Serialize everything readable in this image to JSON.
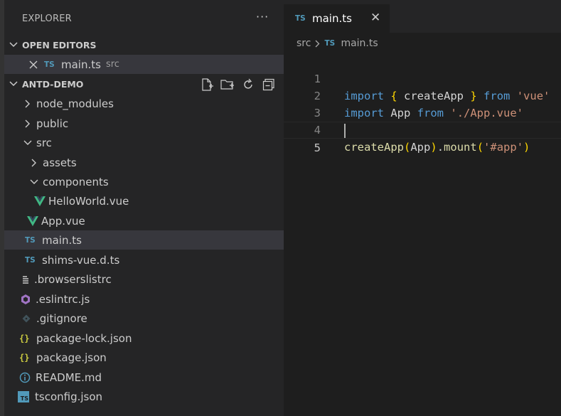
{
  "explorer": {
    "title": "EXPLORER",
    "more": "···",
    "open_editors": {
      "title": "OPEN EDITORS",
      "items": [
        {
          "label": "main.ts",
          "desc": "src",
          "badge": "TS"
        }
      ]
    },
    "project": {
      "title": "ANTD-DEMO",
      "tree": [
        {
          "label": "node_modules"
        },
        {
          "label": "public"
        },
        {
          "label": "src"
        },
        {
          "label": "assets"
        },
        {
          "label": "components"
        },
        {
          "label": "HelloWorld.vue"
        },
        {
          "label": "App.vue"
        },
        {
          "label": "main.ts",
          "badge": "TS"
        },
        {
          "label": "shims-vue.d.ts",
          "badge": "TS"
        },
        {
          "label": ".browserslistrc"
        },
        {
          "label": ".eslintrc.js"
        },
        {
          "label": ".gitignore"
        },
        {
          "label": "package-lock.json",
          "badge": "{}"
        },
        {
          "label": "package.json",
          "badge": "{}"
        },
        {
          "label": "README.md"
        },
        {
          "label": "tsconfig.json",
          "badge": "TS"
        }
      ]
    }
  },
  "editor": {
    "tab": {
      "title": "main.ts",
      "badge": "TS",
      "close": "✕"
    },
    "breadcrumb": {
      "folder": "src",
      "separator": ">",
      "badge": "TS",
      "file": "main.ts"
    },
    "line_numbers": [
      "1",
      "2",
      "3",
      "4",
      "5"
    ],
    "code": {
      "l1": {
        "kw1": "import",
        "b1": "{",
        "name": " createApp ",
        "b2": "}",
        "kw2": "from",
        "str": "'vue'"
      },
      "l2": {
        "kw1": "import",
        "name": "App",
        "kw2": "from",
        "str": "'./App.vue'"
      },
      "l4": {
        "fn1": "createApp",
        "p1": "(",
        "arg": "App",
        "p2": ")",
        "dot": ".",
        "fn2": "mount",
        "p3": "(",
        "str": "'#app'",
        "p4": ")"
      }
    }
  },
  "colors": {
    "ts_blue": "#519aba",
    "vue_green": "#41b883",
    "json_yellow": "#cbcb41",
    "eslint_purple": "#a074c4",
    "keyword": "#569cd6",
    "string": "#ce9178",
    "function": "#dcdcaa"
  }
}
